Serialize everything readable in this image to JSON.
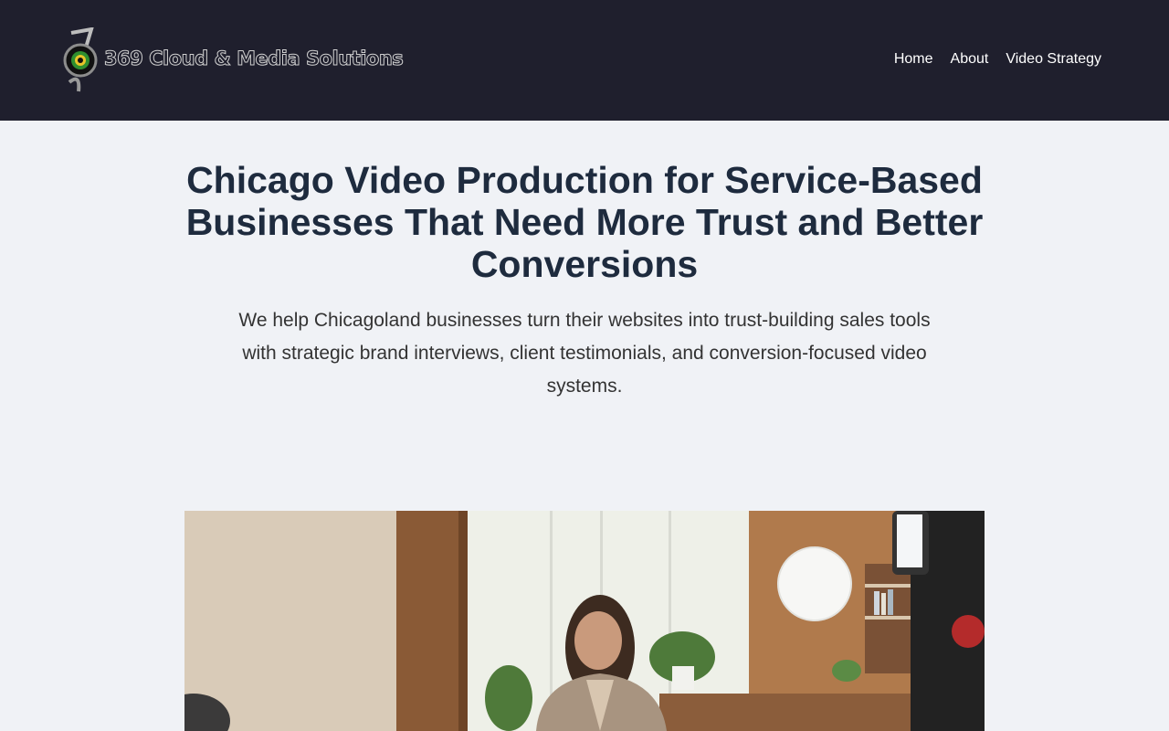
{
  "header": {
    "logo_text": "369 Cloud & Media Solutions",
    "nav": {
      "home": "Home",
      "about": "About",
      "video_strategy": "Video Strategy"
    }
  },
  "hero": {
    "title": "Chicago Video Production for Service-Based Businesses That Need More Trust and Better Conversions",
    "subtitle": "We help Chicagoland businesses turn their websites into trust-building sales tools with strategic brand interviews, client testimonials, and conversion-focused video systems."
  },
  "image": {
    "subject": "woman being interviewed in a bright office with softbox light and camera in foreground"
  },
  "colors": {
    "header_bg": "#1f1f2d",
    "page_bg": "#f0f2f6",
    "title": "#1e2b3e",
    "body_text": "#333333"
  }
}
